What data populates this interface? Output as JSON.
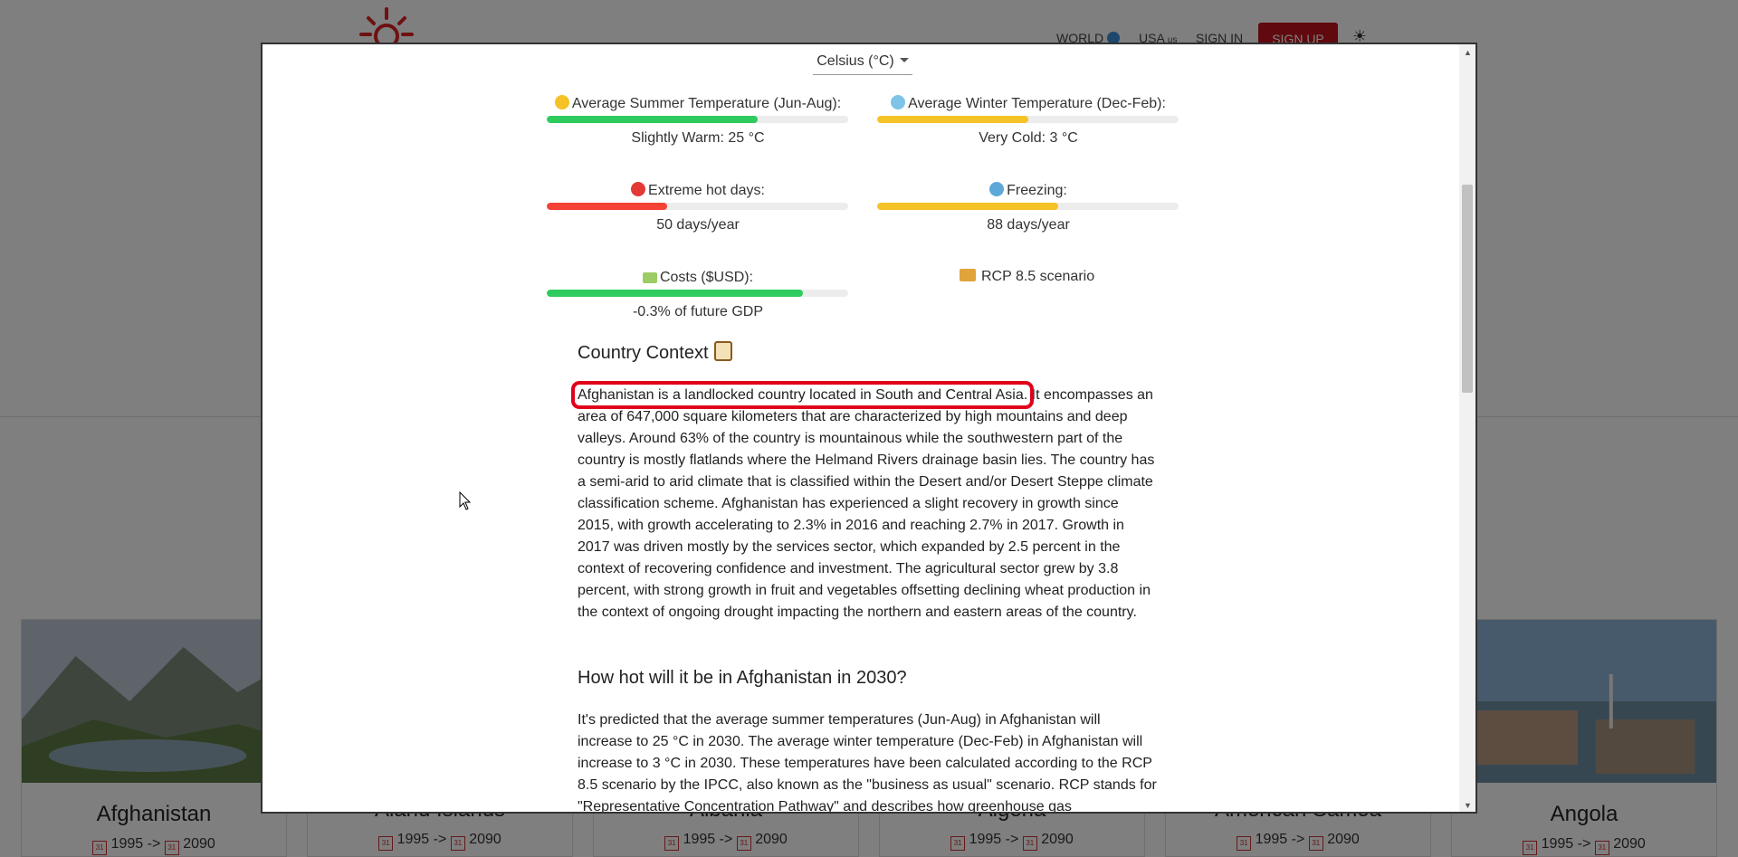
{
  "background": {
    "nav": {
      "world": "WORLD",
      "usa": "USA",
      "usa_flag": "us",
      "signin": "SIGN IN",
      "signup": "SIGN UP"
    },
    "cards": [
      {
        "name": "Afghanistan",
        "start_year": "1995",
        "end_year": "2090",
        "arrow": "->"
      },
      {
        "name": "Aland Islands",
        "start_year": "1995",
        "end_year": "2090",
        "arrow": "->"
      },
      {
        "name": "Albania",
        "start_year": "1995",
        "end_year": "2090",
        "arrow": "->"
      },
      {
        "name": "Algeria",
        "start_year": "1995",
        "end_year": "2090",
        "arrow": "->"
      },
      {
        "name": "American Samoa",
        "start_year": "1995",
        "end_year": "2090",
        "arrow": "->"
      },
      {
        "name": "Angola",
        "start_year": "1995",
        "end_year": "2090",
        "arrow": "->"
      }
    ],
    "calendar_glyph": "31"
  },
  "modal": {
    "unit_select": "Celsius (°C)",
    "stats": [
      {
        "label": "Average Summer Temperature (Jun-Aug):",
        "value": "Slightly Warm: 25 °C",
        "level": 0.7,
        "color": "#2ecc5e",
        "icon": "sun-icon"
      },
      {
        "label": "Average Winter Temperature (Dec-Feb):",
        "value": "Very Cold: 3 °C",
        "level": 0.5,
        "color": "#f5c227",
        "icon": "snowflake-icon"
      },
      {
        "label": "Extreme hot days:",
        "value": "50 days/year",
        "level": 0.4,
        "color": "#f44336",
        "icon": "hot-face-icon"
      },
      {
        "label": "Freezing:",
        "value": "88 days/year",
        "level": 0.6,
        "color": "#f5c227",
        "icon": "cold-face-icon"
      },
      {
        "label": "Costs ($USD):",
        "value": "-0.3% of future GDP",
        "level": 0.85,
        "color": "#2ecc5e",
        "icon": "money-icon"
      }
    ],
    "rcp": "RCP 8.5 scenario",
    "context_title": "Country Context",
    "context_highlight": "Afghanistan is a landlocked country located in South and Central Asia.",
    "context_text": " It encompasses an area of 647,000 square kilometers that are characterized by high mountains and deep valleys. Around 63% of the country is mountainous while the southwestern part of the country is mostly flatlands where the Helmand Rivers drainage basin lies. The country has a semi-arid to arid climate that is classified within the Desert and/or Desert Steppe climate classification scheme. Afghanistan has experienced a slight recovery in growth since 2015, with growth accelerating to 2.3% in 2016 and reaching 2.7% in 2017. Growth in 2017 was driven mostly by the services sector, which expanded by 2.5 percent in the context of recovering confidence and investment. The agricultural sector grew by 3.8 percent, with strong growth in fruit and vegetables offsetting declining wheat production in the context of ongoing drought impacting the northern and eastern areas of the country.",
    "hot_title": "How hot will it be in Afghanistan in 2030?",
    "hot_text": "It's predicted that the average summer temperatures (Jun-Aug) in Afghanistan will increase to 25 °C in 2030. The average winter temperature (Dec-Feb) in Afghanistan will increase to 3 °C in 2030. These temperatures have been calculated according to the RCP 8.5 scenario by the IPCC, also known as the \"business as usual\" scenario. RCP stands for \"Representative Concentration Pathway\" and describes how greenhouse gas"
  }
}
